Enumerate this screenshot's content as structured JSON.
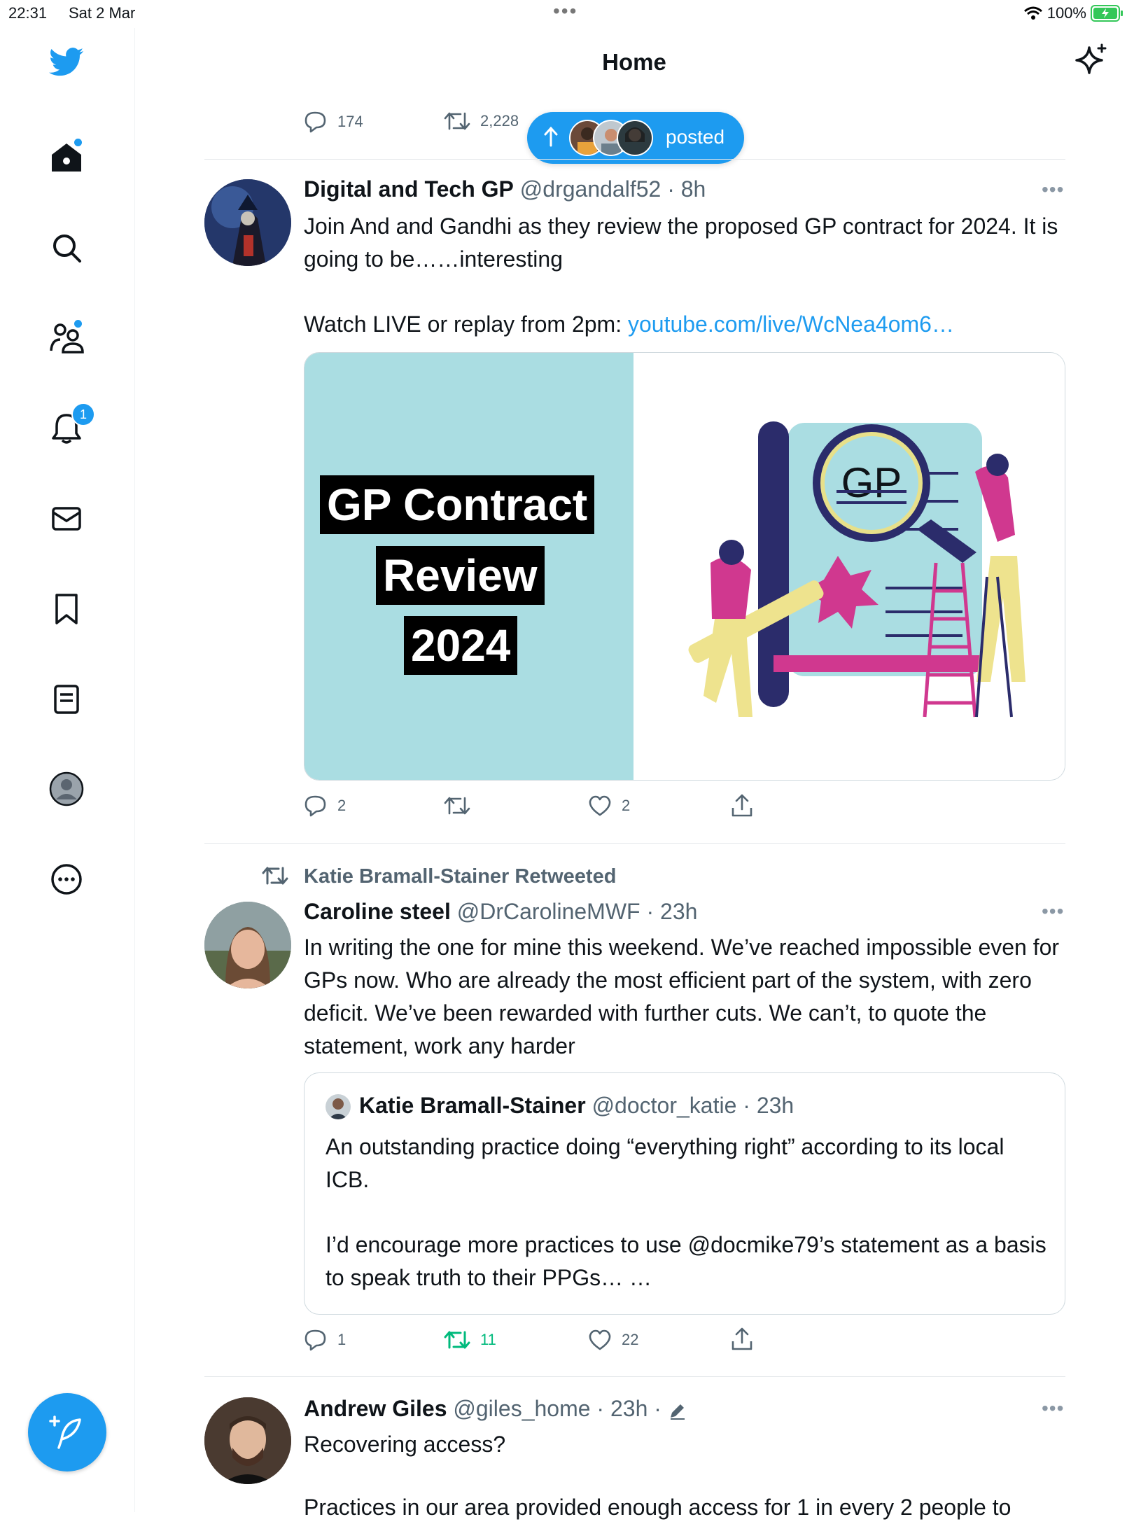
{
  "status_bar": {
    "time": "22:31",
    "date": "Sat 2 Mar",
    "dots": "•••",
    "battery": "100%"
  },
  "header": {
    "title": "Home"
  },
  "sidebar": {
    "notification_count": "1"
  },
  "new_posts_pill": {
    "label": "posted"
  },
  "prev_tweet_actions": {
    "replies": "174",
    "retweets": "2,228"
  },
  "tweets": [
    {
      "name": "Digital and Tech GP",
      "handle": "@drgandalf52",
      "time": "· 8h",
      "text_1": "Join And and Gandhi as they review the proposed GP contract for 2024. It is going to be……interesting",
      "text_2_prefix": "Watch LIVE or replay from 2pm: ",
      "text_2_link": "youtube.com/live/WcNea4om6…",
      "card": {
        "line1": "GP Contract",
        "line2": "Review",
        "line3": "2024",
        "magnifier_text": "GP"
      },
      "actions": {
        "replies": "2",
        "retweets": "",
        "likes": "2"
      }
    },
    {
      "retweeted_by": "Katie Bramall-Stainer Retweeted",
      "name": "Caroline steel",
      "handle": "@DrCarolineMWF",
      "time": "· 23h",
      "text": "In writing the one for mine this weekend. We’ve reached impossible even for GPs now. Who are already the most efficient part of the system, with zero deficit. We’ve been rewarded with further cuts. We can’t, to quote the statement, work any harder",
      "quote": {
        "name": "Katie Bramall-Stainer",
        "handle": "@doctor_katie",
        "time": "· 23h",
        "text_1": "An outstanding practice doing “everything right” according to its local ICB.",
        "text_2": "I’d encourage more practices to use @docmike79’s statement as a basis to speak truth to their PPGs… …"
      },
      "actions": {
        "replies": "1",
        "retweets": "11",
        "likes": "22"
      }
    },
    {
      "name": "Andrew Giles",
      "handle": "@giles_home",
      "time": "· 23h ·",
      "text_1": "Recovering access?",
      "text_2": "Practices in our area provided enough access for 1 in every 2 people to"
    }
  ],
  "more_label": "•••",
  "colors": {
    "accent": "#1d9bf0",
    "retweet_green": "#00ba7c",
    "card_bg": "#aadde2",
    "text": "#0f1419",
    "meta": "#536471"
  }
}
